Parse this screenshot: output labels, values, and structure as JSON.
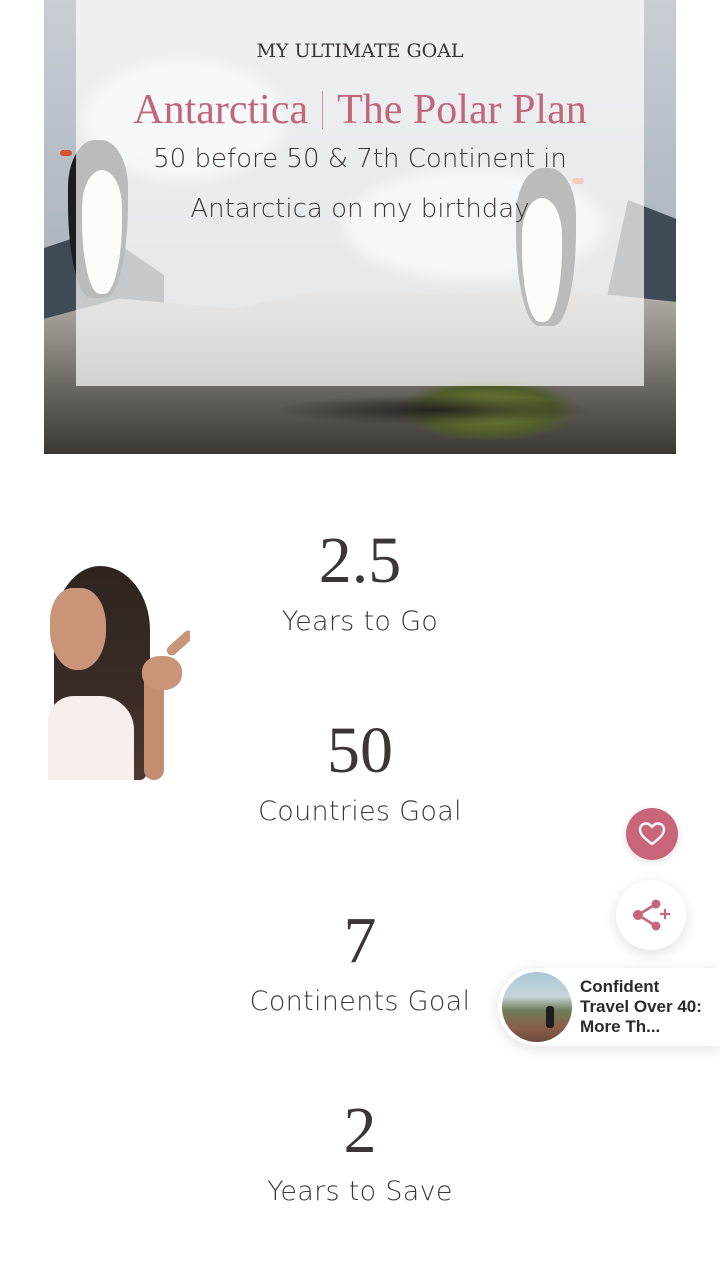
{
  "hero": {
    "eyebrow": "MY ULTIMATE GOAL",
    "title_part1": "Antarctica",
    "title_part2": "The Polar Plan",
    "subtitle": "50 before 50 & 7th Continent in Antarctica on my birthday",
    "accent_color": "#c0687a"
  },
  "stats": [
    {
      "value": "2.5",
      "label": "Years to Go"
    },
    {
      "value": "50",
      "label": "Countries Goal"
    },
    {
      "value": "7",
      "label": "Continents Goal"
    },
    {
      "value": "2",
      "label": "Years to Save"
    }
  ],
  "actions": {
    "like_icon": "heart-icon",
    "share_icon": "share-icon",
    "like_color": "#c9657a"
  },
  "related": {
    "title": "Confident Travel Over 40: More Th..."
  }
}
